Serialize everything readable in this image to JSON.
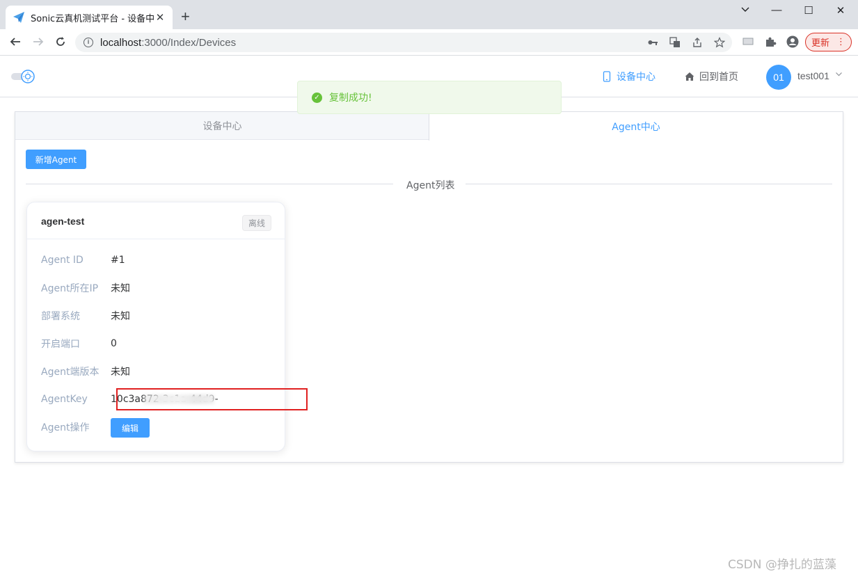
{
  "browser": {
    "tab_title": "Sonic云真机测试平台 - 设备中心",
    "tab_close": "✕",
    "new_tab": "+",
    "url_host": "localhost",
    "url_rest": ":3000/Index/Devices",
    "update_label": "更新",
    "window_controls": {
      "minimize": "—",
      "maximize": "☐",
      "close": "✕"
    }
  },
  "header": {
    "menu_devices": "设备中心",
    "menu_home": "回到首页",
    "avatar_text": "01",
    "username": "test001"
  },
  "toast": {
    "message": "复制成功!"
  },
  "tabs": [
    {
      "label": "设备中心",
      "active": false
    },
    {
      "label": "Agent中心",
      "active": true
    }
  ],
  "add_agent_button": "新增Agent",
  "divider_label": "Agent列表",
  "agent": {
    "name": "agen-test",
    "status": "离线",
    "fields": [
      {
        "label": "Agent ID",
        "value": "#1"
      },
      {
        "label": "Agent所在IP",
        "value": "未知"
      },
      {
        "label": "部署系统",
        "value": "未知"
      },
      {
        "label": "开启端口",
        "value": "0"
      },
      {
        "label": "Agent端版本",
        "value": "未知"
      },
      {
        "label": "AgentKey",
        "value": "10c3a872-3c1a-44d9-"
      },
      {
        "label": "Agent操作",
        "value": ""
      }
    ],
    "edit_button": "编辑"
  },
  "watermark": "CSDN @挣扎的蓝藻",
  "colors": {
    "primary": "#409eff",
    "success": "#67c23a",
    "highlight": "#e02020"
  }
}
